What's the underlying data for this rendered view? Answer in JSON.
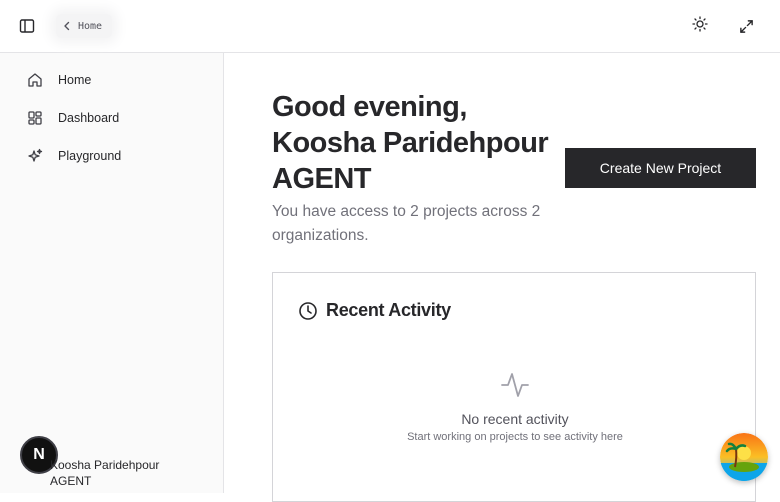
{
  "header": {
    "breadcrumb_label": "Home",
    "icons": [
      "sidebar-toggle-icon",
      "chevron-left-icon",
      "sun-icon",
      "expand-icon"
    ]
  },
  "sidebar": {
    "items": [
      {
        "label": "Home",
        "icon": "home-icon"
      },
      {
        "label": "Dashboard",
        "icon": "dashboard-icon"
      },
      {
        "label": "Playground",
        "icon": "sparkles-icon"
      }
    ],
    "user": {
      "name": "Koosha Paridehpour AGENT",
      "avatar_letter": "N"
    }
  },
  "main": {
    "greeting": "Good evening, Koosha Paridehpour AGENT",
    "subtitle": "You have access to 2 projects across 2 organizations.",
    "create_button": "Create New Project",
    "recent_activity": {
      "title": "Recent Activity",
      "icon": "clock-icon",
      "empty_icon": "activity-icon",
      "empty_title": "No recent activity",
      "empty_subtitle": "Start working on projects to see activity here"
    }
  },
  "colors": {
    "primary_button": "#27272a",
    "sidebar_bg": "#fafafa",
    "border": "#e4e4e7",
    "muted_text": "#71717a"
  }
}
